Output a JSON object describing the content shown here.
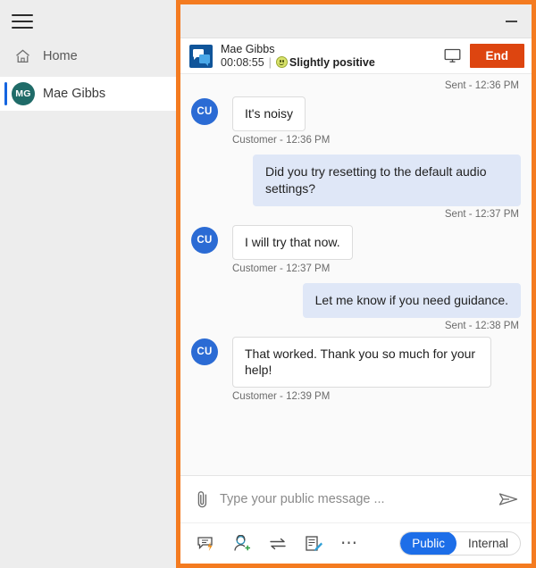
{
  "sidebar": {
    "menu_icon": "hamburger-icon",
    "items": [
      {
        "label": "Home",
        "icon": "home-icon",
        "selected": false
      },
      {
        "label": "Mae Gibbs",
        "icon": "avatar",
        "initials": "MG",
        "selected": true
      }
    ]
  },
  "window": {
    "minimize_label": "—",
    "accent_border": "#f47b20"
  },
  "conversation": {
    "app_icon": "chat-icon",
    "customer_name": "Mae Gibbs",
    "timer": "00:08:55",
    "divider": "|",
    "sentiment_icon": "slightly-positive-smiley-icon",
    "sentiment": "Slightly positive",
    "monitor_icon": "monitor-icon",
    "end_label": "End",
    "end_color": "#dd4510"
  },
  "messages": [
    {
      "type": "stamp-right",
      "text": "Sent - 12:36 PM"
    },
    {
      "type": "incoming",
      "initials": "CU",
      "text": "It's noisy"
    },
    {
      "type": "stamp-left",
      "text": "Customer - 12:36 PM"
    },
    {
      "type": "outgoing",
      "text": "Did you try resetting to the default audio settings?"
    },
    {
      "type": "stamp-right",
      "text": "Sent - 12:37 PM"
    },
    {
      "type": "incoming",
      "initials": "CU",
      "text": "I will try that now."
    },
    {
      "type": "stamp-left",
      "text": "Customer - 12:37 PM"
    },
    {
      "type": "outgoing",
      "text": "Let me know if you need guidance."
    },
    {
      "type": "stamp-right",
      "text": "Sent - 12:38 PM"
    },
    {
      "type": "incoming",
      "initials": "CU",
      "text": "That worked. Thank you so much for your help!"
    },
    {
      "type": "stamp-left",
      "text": "Customer - 12:39 PM"
    }
  ],
  "composer": {
    "attach_icon": "paperclip-icon",
    "input_value": "",
    "input_placeholder": "Type your public message ...",
    "send_icon": "send-icon",
    "tools": [
      {
        "name": "quick-reply-icon"
      },
      {
        "name": "add-agent-icon"
      },
      {
        "name": "transfer-icon"
      },
      {
        "name": "notes-icon"
      },
      {
        "name": "more-icon",
        "label": "⋯"
      }
    ],
    "scope": {
      "public_label": "Public",
      "internal_label": "Internal",
      "selected": "Public",
      "active_color": "#1d6ee8"
    }
  }
}
